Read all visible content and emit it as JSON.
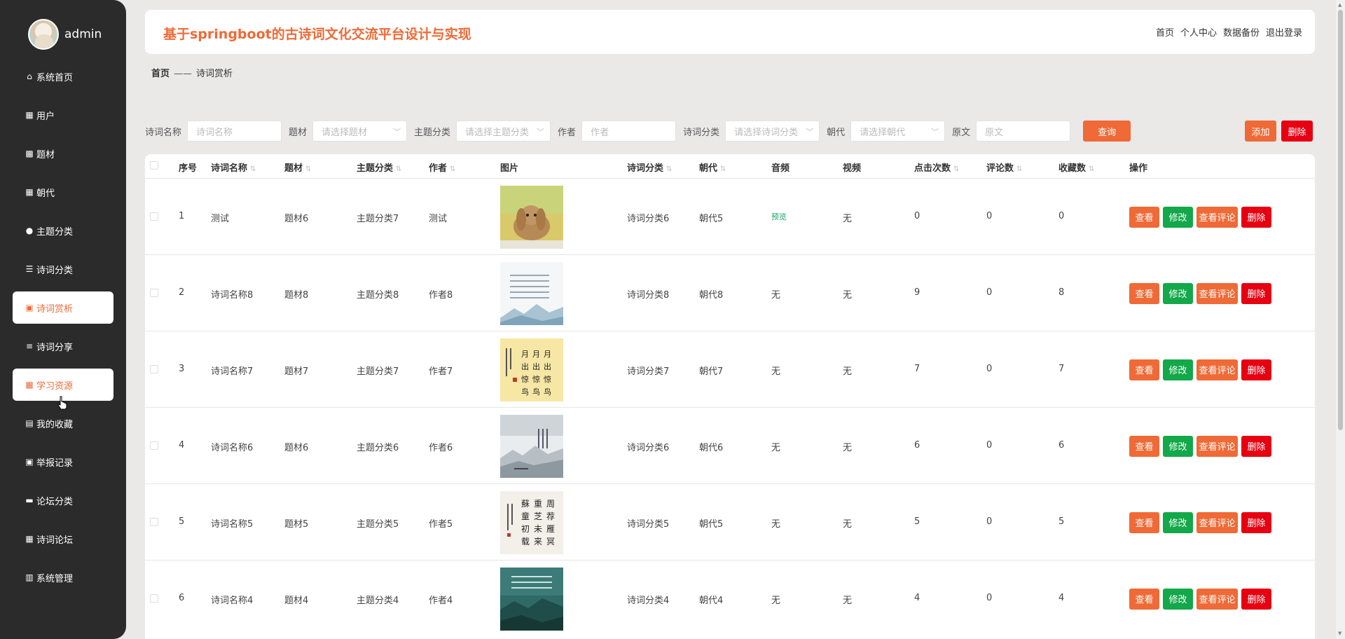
{
  "user": {
    "name": "admin"
  },
  "sidebar": {
    "items": [
      {
        "label": "系统首页",
        "icon": "home-icon",
        "glyph": "⌂",
        "active": false
      },
      {
        "label": "用户",
        "icon": "grid-icon",
        "glyph": "▦",
        "active": false
      },
      {
        "label": "题材",
        "icon": "chart-icon",
        "glyph": "▩",
        "active": false
      },
      {
        "label": "朝代",
        "icon": "grid-icon",
        "glyph": "▦",
        "active": false
      },
      {
        "label": "主题分类",
        "icon": "bulb-icon",
        "glyph": "●",
        "active": false
      },
      {
        "label": "诗词分类",
        "icon": "sliders-icon",
        "glyph": "☰",
        "active": false
      },
      {
        "label": "诗词赏析",
        "icon": "clipboard-icon",
        "glyph": "▣",
        "active": true
      },
      {
        "label": "诗词分享",
        "icon": "list-icon",
        "glyph": "≡",
        "active": false
      },
      {
        "label": "学习资源",
        "icon": "grid-icon",
        "glyph": "▦",
        "active": true
      },
      {
        "label": "我的收藏",
        "icon": "briefcase-icon",
        "glyph": "▤",
        "active": false
      },
      {
        "label": "举报记录",
        "icon": "clipboard-icon",
        "glyph": "▣",
        "active": false
      },
      {
        "label": "论坛分类",
        "icon": "monitor-icon",
        "glyph": "▬",
        "active": false
      },
      {
        "label": "诗词论坛",
        "icon": "grid-icon",
        "glyph": "▦",
        "active": false
      },
      {
        "label": "系统管理",
        "icon": "bars-icon",
        "glyph": "▥",
        "active": false
      }
    ]
  },
  "header": {
    "title": "基于springboot的古诗词文化交流平台设计与实现",
    "links": [
      "首页",
      "个人中心",
      "数据备份",
      "退出登录"
    ]
  },
  "breadcrumb": {
    "home": "首页",
    "sep": "——",
    "current": "诗词赏析"
  },
  "search": {
    "fields": [
      {
        "label": "诗词名称",
        "placeholder": "诗词名称",
        "select": false,
        "width": 135
      },
      {
        "label": "题材",
        "placeholder": "请选择题材",
        "select": true,
        "width": 135
      },
      {
        "label": "主题分类",
        "placeholder": "请选择主题分类",
        "select": true,
        "width": 135
      },
      {
        "label": "作者",
        "placeholder": "作者",
        "select": false,
        "width": 135
      },
      {
        "label": "诗词分类",
        "placeholder": "请选择诗词分类",
        "select": true,
        "width": 135
      },
      {
        "label": "朝代",
        "placeholder": "请选择朝代",
        "select": true,
        "width": 135
      },
      {
        "label": "原文",
        "placeholder": "原文",
        "select": false,
        "width": 135
      }
    ],
    "query_label": "查询",
    "add_label": "添加",
    "delete_label": "删除"
  },
  "table": {
    "headers": [
      "序号",
      "诗词名称",
      "题材",
      "主题分类",
      "作者",
      "图片",
      "诗词分类",
      "朝代",
      "音频",
      "视频",
      "点击次数",
      "评论数",
      "收藏数",
      "操作"
    ],
    "sortable": [
      false,
      true,
      true,
      true,
      true,
      false,
      true,
      true,
      false,
      false,
      true,
      true,
      true,
      false
    ],
    "ops": {
      "view": "查看",
      "edit": "修改",
      "comments": "查看评论",
      "delete": "删除"
    },
    "rows": [
      {
        "no": "1",
        "name": "测试",
        "theme": "题材6",
        "topic": "主题分类7",
        "author": "测试",
        "image": "rabbit-photo",
        "category": "诗词分类6",
        "dynasty": "朝代5",
        "audio": "预览",
        "video": "无",
        "clicks": "0",
        "comments": "0",
        "favorites": "0"
      },
      {
        "no": "2",
        "name": "诗词名称8",
        "theme": "题材8",
        "topic": "主题分类8",
        "author": "作者8",
        "image": "landscape-poem",
        "category": "诗词分类8",
        "dynasty": "朝代8",
        "audio": "无",
        "video": "无",
        "clicks": "9",
        "comments": "0",
        "favorites": "8"
      },
      {
        "no": "3",
        "name": "诗词名称7",
        "theme": "题材7",
        "topic": "主题分类7",
        "author": "作者7",
        "image": "calligraphy-yellow",
        "category": "诗词分类7",
        "dynasty": "朝代7",
        "audio": "无",
        "video": "无",
        "clicks": "7",
        "comments": "0",
        "favorites": "7"
      },
      {
        "no": "4",
        "name": "诗词名称6",
        "theme": "题材6",
        "topic": "主题分类6",
        "author": "作者6",
        "image": "ink-landscape",
        "category": "诗词分类6",
        "dynasty": "朝代6",
        "audio": "无",
        "video": "无",
        "clicks": "6",
        "comments": "0",
        "favorites": "6"
      },
      {
        "no": "5",
        "name": "诗词名称5",
        "theme": "题材5",
        "topic": "主题分类5",
        "author": "作者5",
        "image": "calligraphy-white",
        "category": "诗词分类5",
        "dynasty": "朝代5",
        "audio": "无",
        "video": "无",
        "clicks": "5",
        "comments": "0",
        "favorites": "5"
      },
      {
        "no": "6",
        "name": "诗词名称4",
        "theme": "题材4",
        "topic": "主题分类4",
        "author": "作者4",
        "image": "teal-poster",
        "category": "诗词分类4",
        "dynasty": "朝代4",
        "audio": "无",
        "video": "无",
        "clicks": "4",
        "comments": "0",
        "favorites": "4"
      }
    ]
  }
}
